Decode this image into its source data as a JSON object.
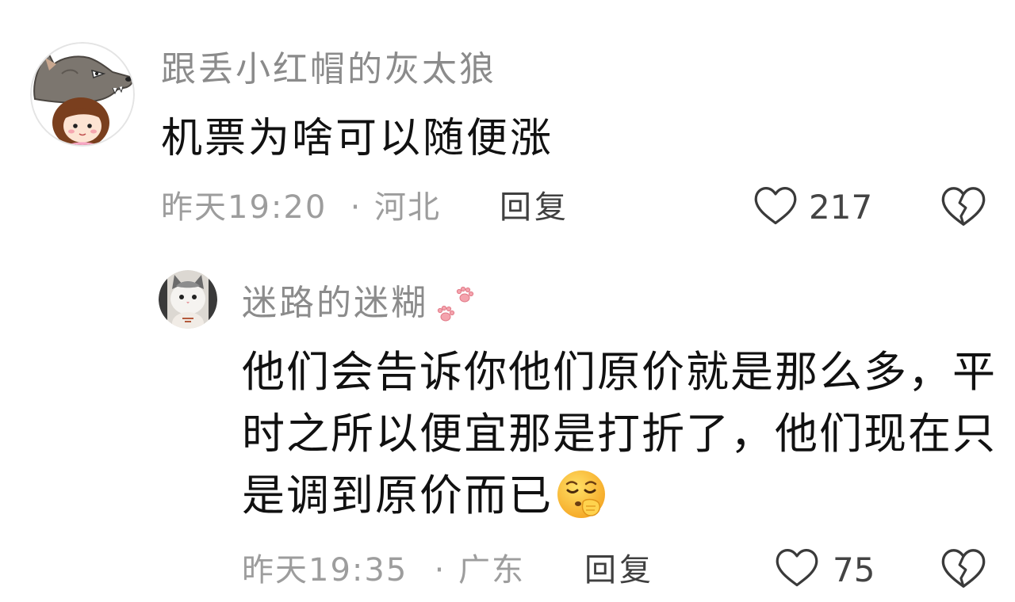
{
  "comments": [
    {
      "avatar_icon": "wolf-girl-avatar",
      "username": "跟丢小红帽的灰太狼",
      "text": "机票为啥可以随便涨",
      "time": "昨天19:20",
      "separator": "·",
      "location": "河北",
      "reply_label": "回复",
      "likes": "217"
    },
    {
      "avatar_icon": "cat-avatar",
      "username": "迷路的迷糊",
      "username_badge_icon": "paw-prints-icon",
      "text": "他们会告诉你他们原价就是那么多，平时之所以便宜那是打折了，他们现在只是调到原价而已",
      "text_trailing_emoji": "hand-over-mouth-face-emoji",
      "time": "昨天19:35",
      "separator": "·",
      "location": "广东",
      "reply_label": "回复",
      "likes": "75"
    }
  ],
  "icons": {
    "like": "heart-outline-icon",
    "dislike": "broken-heart-icon"
  },
  "colors": {
    "background": "#ffffff",
    "username": "#8b8b8b",
    "comment_text": "#111111",
    "meta_text": "#9d9d9d",
    "reply_label": "#3f3f3f",
    "like_count": "#444444",
    "icon_stroke": "#3a3a3a",
    "paw_pink": "#f4a3ad"
  }
}
